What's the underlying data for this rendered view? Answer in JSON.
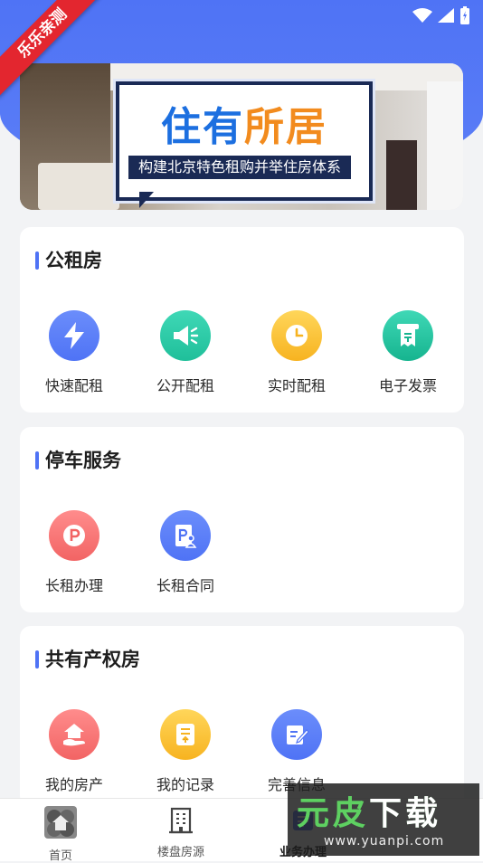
{
  "watermark": {
    "ribbon": "乐乐亲测",
    "logo_main_a": "元皮",
    "logo_main_b": "下载",
    "logo_url": "www.yuanpi.com"
  },
  "banner": {
    "title_a": "住有",
    "title_b": "所居",
    "subtitle": "构建北京特色租购并举住房体系"
  },
  "sections": {
    "public_rental": {
      "title": "公租房",
      "items": [
        {
          "label": "快速配租",
          "icon": "lightning-icon",
          "color": "#4f73f5"
        },
        {
          "label": "公开配租",
          "icon": "megaphone-icon",
          "color": "#22c3a0"
        },
        {
          "label": "实时配租",
          "icon": "clock-icon",
          "color": "#f9bd2b"
        },
        {
          "label": "电子发票",
          "icon": "invoice-icon",
          "color": "#1fc29e"
        }
      ]
    },
    "parking": {
      "title": "停车服务",
      "items": [
        {
          "label": "长租办理",
          "icon": "parking-icon",
          "color": "#f36b6b"
        },
        {
          "label": "长租合同",
          "icon": "parking-contract-icon",
          "color": "#4f73f5"
        }
      ]
    },
    "shared_property": {
      "title": "共有产权房",
      "items": [
        {
          "label": "我的房产",
          "icon": "house-hand-icon",
          "color": "#f36b6b"
        },
        {
          "label": "我的记录",
          "icon": "record-icon",
          "color": "#f9bd2b"
        },
        {
          "label": "完善信息",
          "icon": "edit-form-icon",
          "color": "#4f73f5"
        }
      ]
    }
  },
  "tabbar": {
    "items": [
      {
        "label": "首页",
        "icon": "home-icon",
        "active": false
      },
      {
        "label": "楼盘房源",
        "icon": "building-icon",
        "active": false
      },
      {
        "label": "业务办理",
        "icon": "business-icon",
        "active": true
      }
    ]
  }
}
